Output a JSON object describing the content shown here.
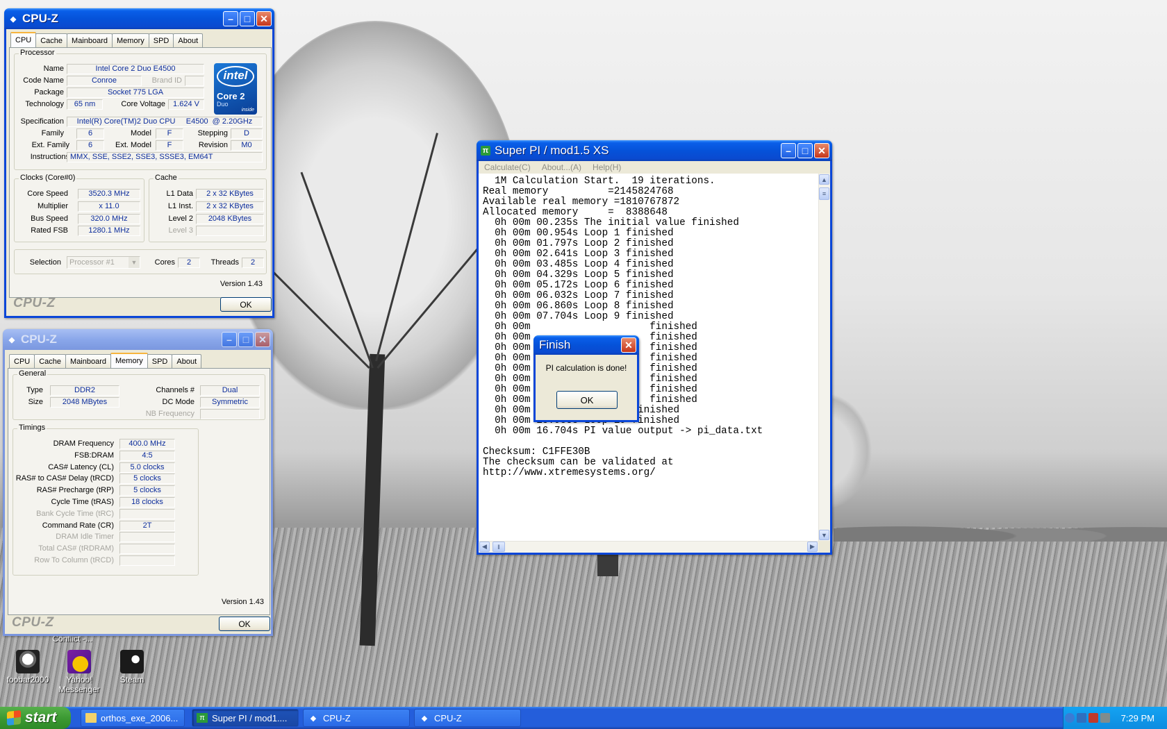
{
  "desktop": {
    "icons": [
      {
        "label": "foobar2000"
      },
      {
        "label": "Yahoo! Messenger"
      },
      {
        "label": "Steam"
      }
    ],
    "partial_icon_label": "Conflict -..."
  },
  "cpuz_cpu": {
    "title": "CPU-Z",
    "tabs": [
      "CPU",
      "Cache",
      "Mainboard",
      "Memory",
      "SPD",
      "About"
    ],
    "active_tab": "CPU",
    "processor": {
      "group": "Processor",
      "name_label": "Name",
      "name": "Intel Core 2 Duo E4500",
      "codename_label": "Code Name",
      "codename": "Conroe",
      "brandid_label": "Brand ID",
      "brandid": "",
      "package_label": "Package",
      "package": "Socket 775 LGA",
      "technology_label": "Technology",
      "technology": "65 nm",
      "corevoltage_label": "Core Voltage",
      "corevoltage": "1.624 V",
      "spec_label": "Specification",
      "spec": "Intel(R) Core(TM)2 Duo CPU     E4500  @ 2.20GHz",
      "family_label": "Family",
      "family": "6",
      "model_label": "Model",
      "model": "F",
      "stepping_label": "Stepping",
      "stepping": "D",
      "extfamily_label": "Ext. Family",
      "extfamily": "6",
      "extmodel_label": "Ext. Model",
      "extmodel": "F",
      "revision_label": "Revision",
      "revision": "M0",
      "instructions_label": "Instructions",
      "instructions": "MMX, SSE, SSE2, SSE3, SSSE3, EM64T",
      "logo": {
        "brand": "intel",
        "line1": "Core 2",
        "line2": "Duo",
        "tag": "inside"
      }
    },
    "clocks": {
      "group": "Clocks (Core#0)",
      "corespeed_label": "Core Speed",
      "corespeed": "3520.3 MHz",
      "multiplier_label": "Multiplier",
      "multiplier": "x 11.0",
      "busspeed_label": "Bus Speed",
      "busspeed": "320.0 MHz",
      "ratedfsb_label": "Rated FSB",
      "ratedfsb": "1280.1 MHz"
    },
    "cache": {
      "group": "Cache",
      "l1data_label": "L1 Data",
      "l1data": "2 x 32 KBytes",
      "l1inst_label": "L1 Inst.",
      "l1inst": "2 x 32 KBytes",
      "level2_label": "Level 2",
      "level2": "2048 KBytes",
      "level3_label": "Level 3",
      "level3": ""
    },
    "selection_label": "Selection",
    "selection": "Processor #1",
    "cores_label": "Cores",
    "cores": "2",
    "threads_label": "Threads",
    "threads": "2",
    "version": "Version 1.43",
    "brand": "CPU-Z",
    "ok": "OK"
  },
  "cpuz_mem": {
    "title": "CPU-Z",
    "tabs": [
      "CPU",
      "Cache",
      "Mainboard",
      "Memory",
      "SPD",
      "About"
    ],
    "active_tab": "Memory",
    "general": {
      "group": "General",
      "type_label": "Type",
      "type": "DDR2",
      "size_label": "Size",
      "size": "2048 MBytes",
      "channels_label": "Channels #",
      "channels": "Dual",
      "dcmode_label": "DC Mode",
      "dcmode": "Symmetric",
      "nbfreq_label": "NB Frequency",
      "nbfreq": ""
    },
    "timings": {
      "group": "Timings",
      "rows": [
        {
          "label": "DRAM Frequency",
          "value": "400.0 MHz",
          "disabled": false
        },
        {
          "label": "FSB:DRAM",
          "value": "4:5",
          "disabled": false
        },
        {
          "label": "CAS# Latency (CL)",
          "value": "5.0 clocks",
          "disabled": false
        },
        {
          "label": "RAS# to CAS# Delay (tRCD)",
          "value": "5 clocks",
          "disabled": false
        },
        {
          "label": "RAS# Precharge (tRP)",
          "value": "5 clocks",
          "disabled": false
        },
        {
          "label": "Cycle Time (tRAS)",
          "value": "18 clocks",
          "disabled": false
        },
        {
          "label": "Bank Cycle Time (tRC)",
          "value": "",
          "disabled": true
        },
        {
          "label": "Command Rate (CR)",
          "value": "2T",
          "disabled": false
        },
        {
          "label": "DRAM Idle Timer",
          "value": "",
          "disabled": true
        },
        {
          "label": "Total CAS# (tRDRAM)",
          "value": "",
          "disabled": true
        },
        {
          "label": "Row To Column (tRCD)",
          "value": "",
          "disabled": true
        }
      ]
    },
    "version": "Version 1.43",
    "brand": "CPU-Z",
    "ok": "OK"
  },
  "superpi": {
    "title": "Super PI / mod1.5 XS",
    "menu": [
      "Calculate(C)",
      "About...(A)",
      "Help(H)"
    ],
    "lines": [
      "  1M Calculation Start.  19 iterations.",
      "Real memory          =2145824768",
      "Available real memory =1810767872",
      "Allocated memory     =  8388648",
      "  0h 00m 00.235s The initial value finished",
      "  0h 00m 00.954s Loop 1 finished",
      "  0h 00m 01.797s Loop 2 finished",
      "  0h 00m 02.641s Loop 3 finished",
      "  0h 00m 03.485s Loop 4 finished",
      "  0h 00m 04.329s Loop 5 finished",
      "  0h 00m 05.172s Loop 6 finished",
      "  0h 00m 06.032s Loop 7 finished",
      "  0h 00m 06.860s Loop 8 finished",
      "  0h 00m 07.704s Loop 9 finished",
      "  0h 00m                    finished",
      "  0h 00m                    finished",
      "  0h 00m                    finished",
      "  0h 00m                    finished",
      "  0h 00m                    finished",
      "  0h 00m                    finished",
      "  0h 00m                    finished",
      "  0h 00m                    finished",
      "  0h 00m 15.204s Loop 18 finished",
      "  0h 00m 15.938s Loop 19 finished",
      "  0h 00m 16.704s PI value output -> pi_data.txt",
      "",
      "Checksum: C1FFE30B",
      "The checksum can be validated at",
      "http://www.xtremesystems.org/"
    ]
  },
  "finish_dialog": {
    "title": "Finish",
    "message": "PI calculation is done!",
    "ok": "OK"
  },
  "taskbar": {
    "start": "start",
    "tasks": [
      {
        "label": "orthos_exe_2006...",
        "icon": "folder-icon",
        "active": false
      },
      {
        "label": "Super PI / mod1....",
        "icon": "superpi-icon",
        "active": true
      },
      {
        "label": "CPU-Z",
        "icon": "cpuz-icon",
        "active": false
      },
      {
        "label": "CPU-Z",
        "icon": "cpuz-icon",
        "active": false
      }
    ],
    "clock": "7:29 PM"
  },
  "colors": {
    "xp_blue": "#0a5fe9",
    "value_text": "#0c2d9c",
    "start_green": "#3c9a33"
  }
}
